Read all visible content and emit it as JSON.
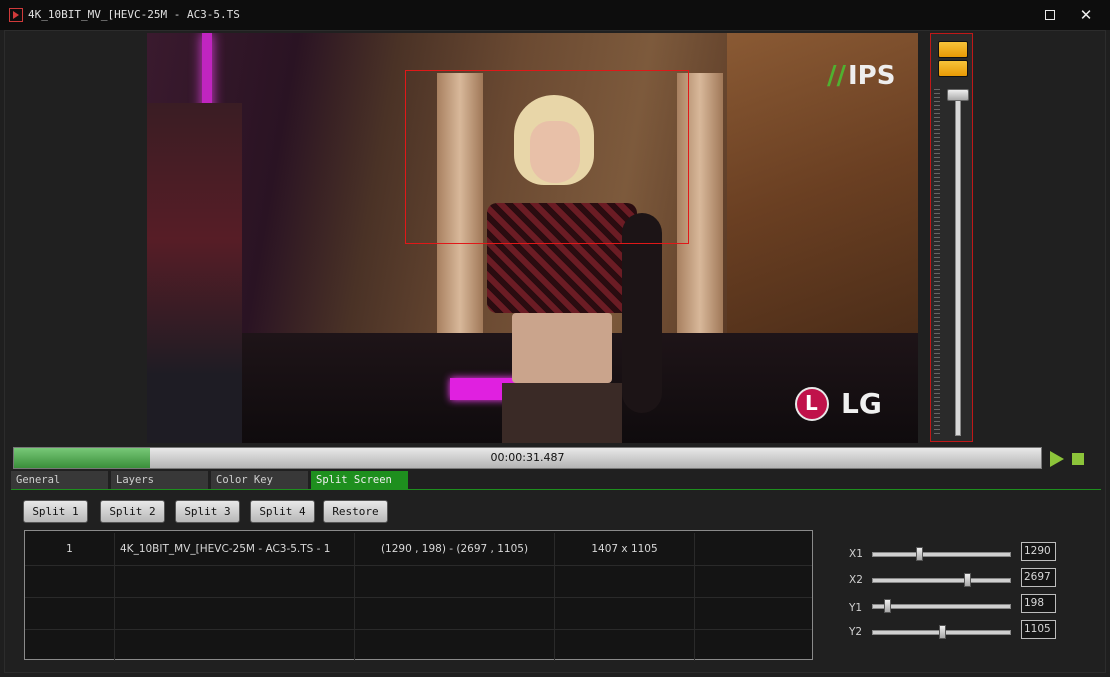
{
  "window": {
    "title": "4K_10BIT_MV_[HEVC-25M - AC3-5.TS"
  },
  "video": {
    "overlay_logo_top": "IPS",
    "overlay_logo_bottom": "LG"
  },
  "vertical_panel": {
    "slider_level": 1.0
  },
  "playback": {
    "time": "00:00:31.487",
    "progress": 0.132
  },
  "tabs": [
    {
      "label": "General"
    },
    {
      "label": "Layers"
    },
    {
      "label": "Color Key"
    },
    {
      "label": "Split Screen",
      "active": true
    }
  ],
  "buttons": {
    "split1": "Split 1",
    "split2": "Split 2",
    "split3": "Split 3",
    "split4": "Split 4",
    "restore": "Restore"
  },
  "table": {
    "rows": [
      {
        "index": "1",
        "name": "4K_10BIT_MV_[HEVC-25M - AC3-5.TS - 1",
        "region": "(1290 ,  198)  -  (2697 , 1105)",
        "size": "1407 x 1105",
        "extra": ""
      },
      {
        "index": "",
        "name": "",
        "region": "",
        "size": "",
        "extra": ""
      },
      {
        "index": "",
        "name": "",
        "region": "",
        "size": "",
        "extra": ""
      },
      {
        "index": "",
        "name": "",
        "region": "",
        "size": "",
        "extra": ""
      }
    ]
  },
  "coords": {
    "x1": {
      "label": "X1",
      "value": "1290"
    },
    "x2": {
      "label": "X2",
      "value": "2697"
    },
    "y1": {
      "label": "Y1",
      "value": "198"
    },
    "y2": {
      "label": "Y2",
      "value": "1105"
    }
  },
  "colors": {
    "accent_green": "#1e8f1e",
    "roi_red": "#e01818",
    "play_green": "#8cc43a"
  }
}
